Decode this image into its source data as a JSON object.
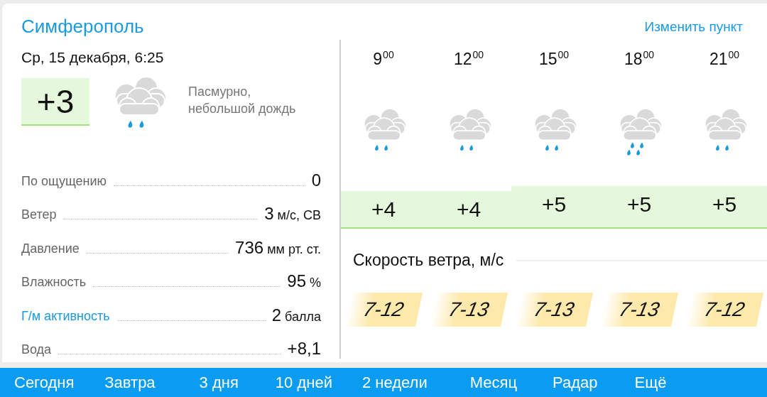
{
  "city": "Симферополь",
  "change_link": "Изменить пункт",
  "current": {
    "datetime": "Ср, 15 декабря, 6:25",
    "temperature": "+3",
    "kind": "light_rain",
    "description": "Пасмурно,\nнебольшой дождь"
  },
  "details": [
    {
      "label": "По ощущению",
      "value": "0",
      "kind": "plain"
    },
    {
      "label": "Ветер",
      "value": "3",
      "unit": "м/с, СВ",
      "kind": "plain"
    },
    {
      "label": "Давление",
      "value": "736",
      "unit": "мм рт. ст.",
      "kind": "plain"
    },
    {
      "label": "Влажность",
      "value": "95",
      "unit": "%",
      "kind": "plain"
    },
    {
      "label": "Г/м активность",
      "value": "2",
      "unit": "балла",
      "kind": "link"
    },
    {
      "label": "Вода",
      "value": "+8,1",
      "kind": "plain"
    }
  ],
  "hours": [
    {
      "time": "9$^{00}$",
      "kind": "light_rain",
      "temperature": "+4",
      "raised": false,
      "wind": "7-12"
    },
    {
      "time": "12$^{00}$",
      "kind": "light_rain",
      "temperature": "+4",
      "raised": false,
      "wind": "7-13"
    },
    {
      "time": "15$^{00}$",
      "kind": "light_rain",
      "temperature": "+5",
      "raised": true,
      "wind": "7-13"
    },
    {
      "time": "18$^{00}$",
      "kind": "rain",
      "temperature": "+5",
      "raised": true,
      "wind": "7-13"
    },
    {
      "time": "21$^{00}$",
      "kind": "light_rain",
      "temperature": "+5",
      "raised": true,
      "wind": "7-12"
    }
  ],
  "wind_title": "Скорость ветра, м/с",
  "nav_tabs": [
    "Сегодня",
    "Завтра",
    "3 дня",
    "10 дней",
    "2 недели",
    "Месяц",
    "Радар",
    "Ещё"
  ]
}
